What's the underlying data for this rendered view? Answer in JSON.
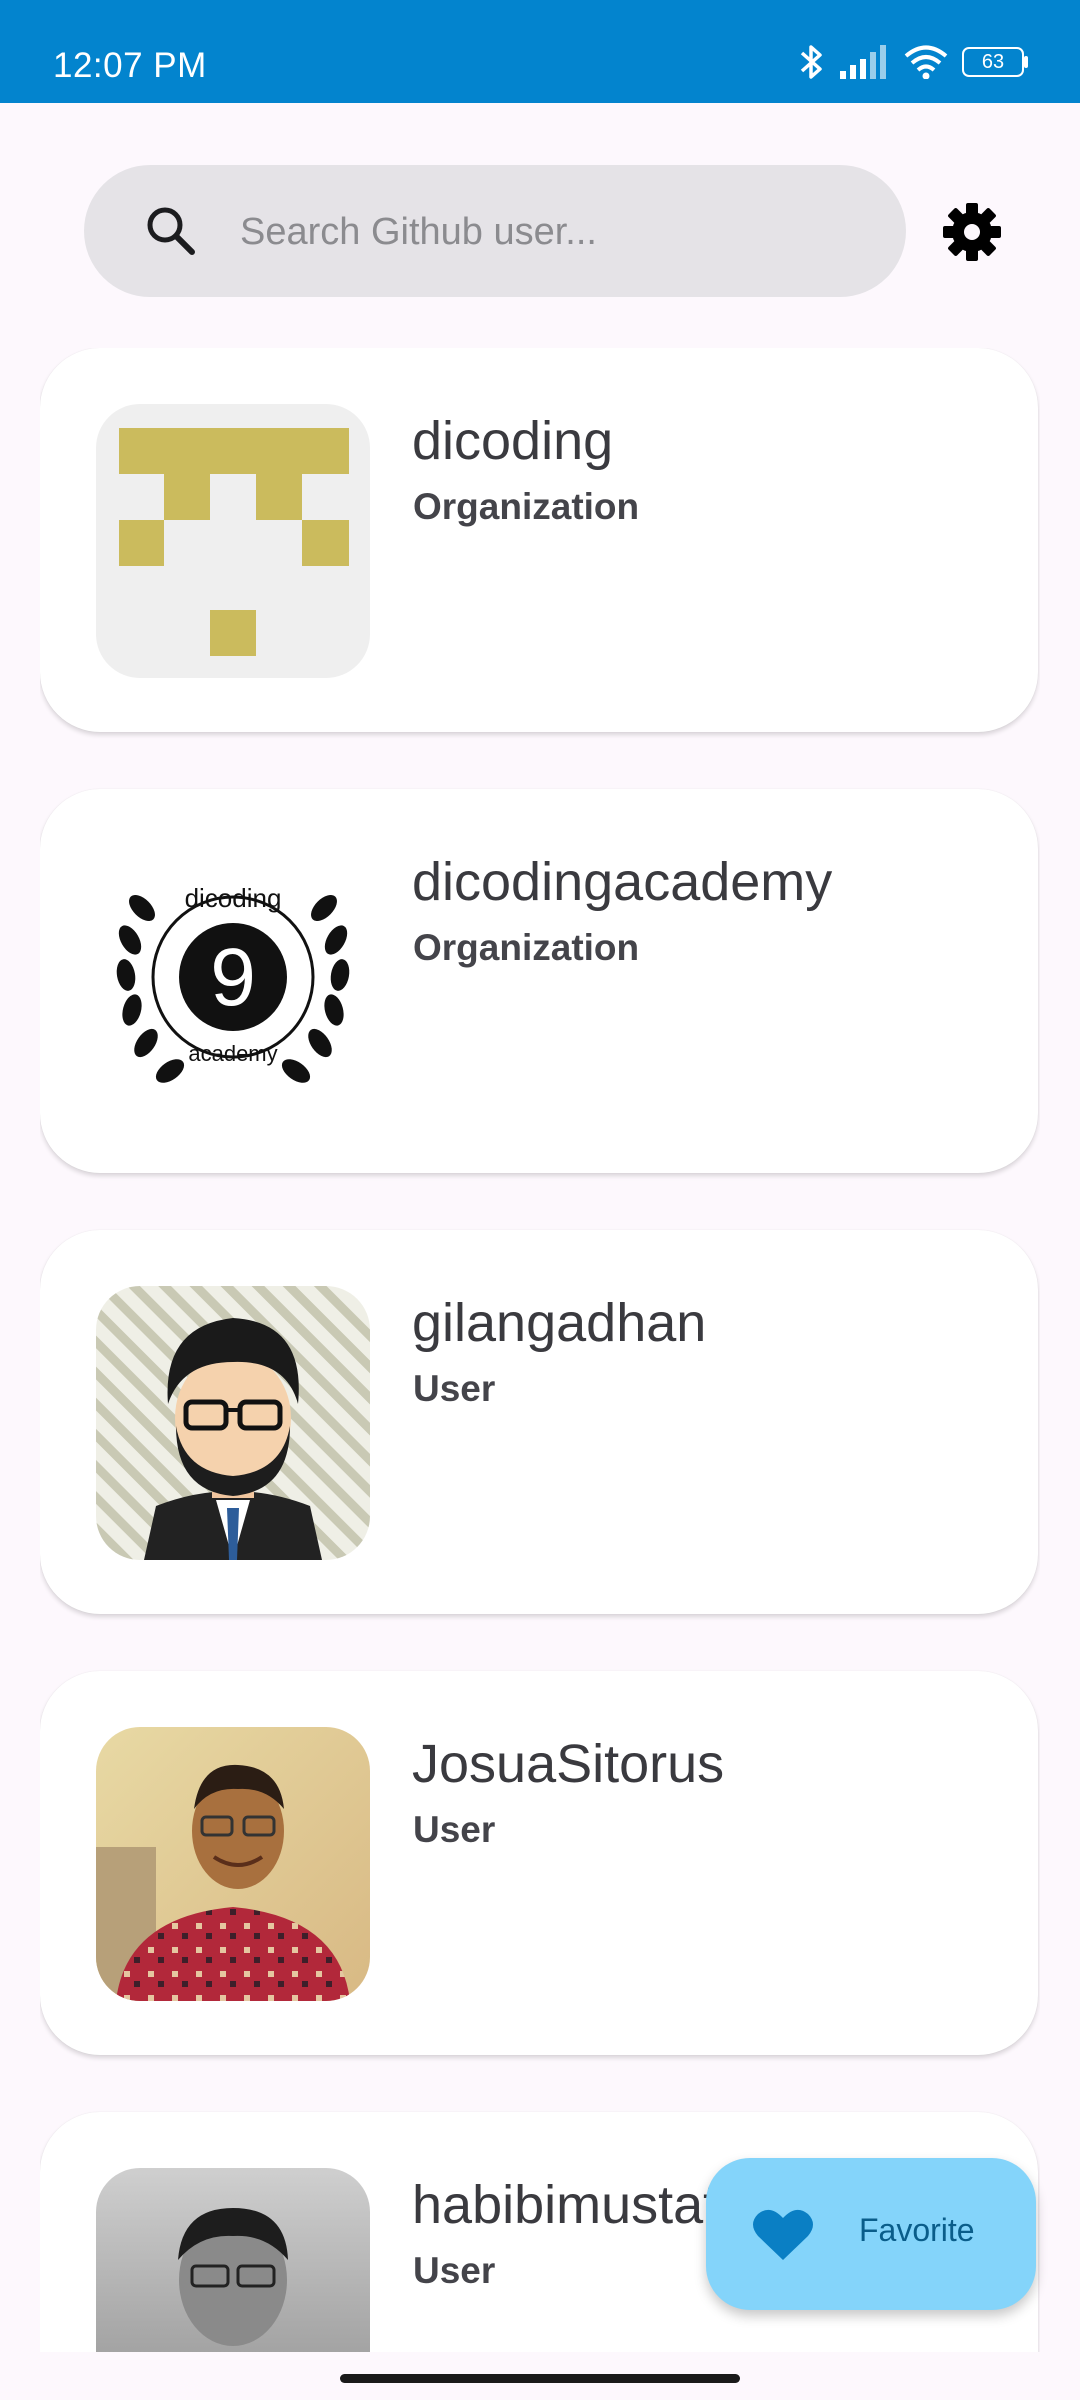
{
  "status_bar": {
    "time": "12:07 PM",
    "battery": "63",
    "icons": [
      "bluetooth-icon",
      "signal-icon",
      "wifi-icon",
      "battery-icon"
    ]
  },
  "search": {
    "placeholder": "Search Github user...",
    "value": ""
  },
  "settings": {
    "icon": "gear-icon"
  },
  "users": [
    {
      "name": "dicoding",
      "type": "Organization"
    },
    {
      "name": "dicodingacademy",
      "type": "Organization",
      "avatar_text_top": "dicoding",
      "avatar_text_bottom": "academy",
      "avatar_glyph": "9"
    },
    {
      "name": "gilangadhan",
      "type": "User"
    },
    {
      "name": "JosuaSitorus",
      "type": "User"
    },
    {
      "name": "habibimustafa",
      "type": "User"
    }
  ],
  "fab": {
    "label": "Favorite",
    "icon": "heart-icon"
  },
  "colors": {
    "status_bar": "#0384ce",
    "fab_background": "#84d4fa",
    "fab_icon": "#0a7fc4",
    "dicoding_gold": "#cbbb5d"
  }
}
